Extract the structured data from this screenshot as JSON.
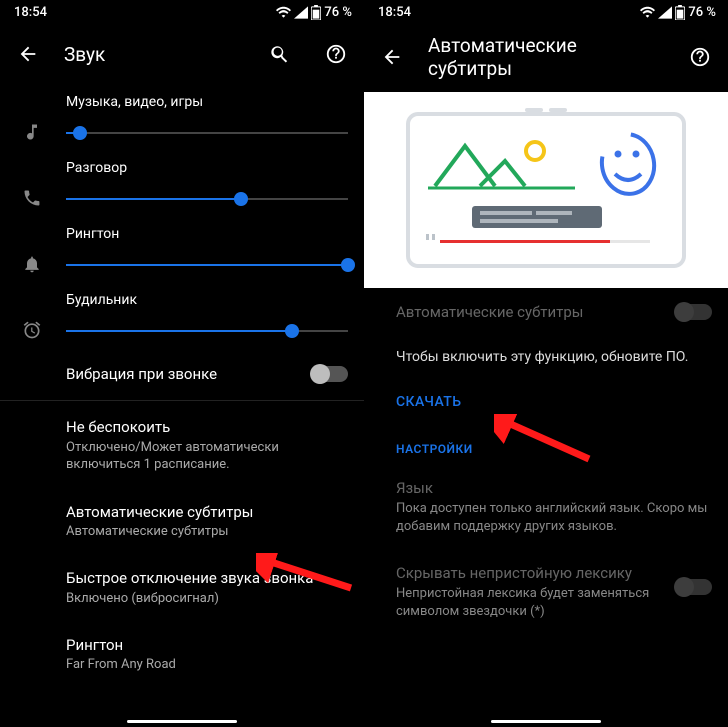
{
  "status": {
    "time": "18:54",
    "battery": "76 %"
  },
  "left": {
    "title": "Звук",
    "sliders": [
      {
        "label": "Музыка, видео, игры",
        "value": 5,
        "color": "#1a73e8"
      },
      {
        "label": "Разговор",
        "value": 62,
        "color": "#1a73e8"
      },
      {
        "label": "Рингтон",
        "value": 100,
        "color": "#1a73e8"
      },
      {
        "label": "Будильник",
        "value": 80,
        "color": "#1a73e8"
      }
    ],
    "vibrate": {
      "label": "Вибрация при звонке",
      "on": false
    },
    "rows": [
      {
        "label": "Не беспокоить",
        "sub": "Отключено/Может автоматически включиться 1 расписание."
      },
      {
        "label": "Автоматические субтитры",
        "sub": "Автоматические субтитры"
      },
      {
        "label": "Быстрое отключение звука звонка",
        "sub": "Включено (вибросигнал)"
      },
      {
        "label": "Рингтон",
        "sub": "Far From Any Road"
      }
    ]
  },
  "right": {
    "title": "Автоматические субтитры",
    "toggle": {
      "label": "Автоматические субтитры",
      "enabled": false
    },
    "hint": "Чтобы включить эту функцию, обновите ПО.",
    "download": "СКАЧАТЬ",
    "section": "НАСТРОЙКИ",
    "rows": [
      {
        "label": "Язык",
        "sub": "Пока доступен только английский язык. Скоро мы добавим поддержку других языков."
      },
      {
        "label": "Скрывать непристойную лексику",
        "sub": "Непристойная лексика будет заменяться символом звездочки (*)",
        "switch": true
      }
    ]
  }
}
